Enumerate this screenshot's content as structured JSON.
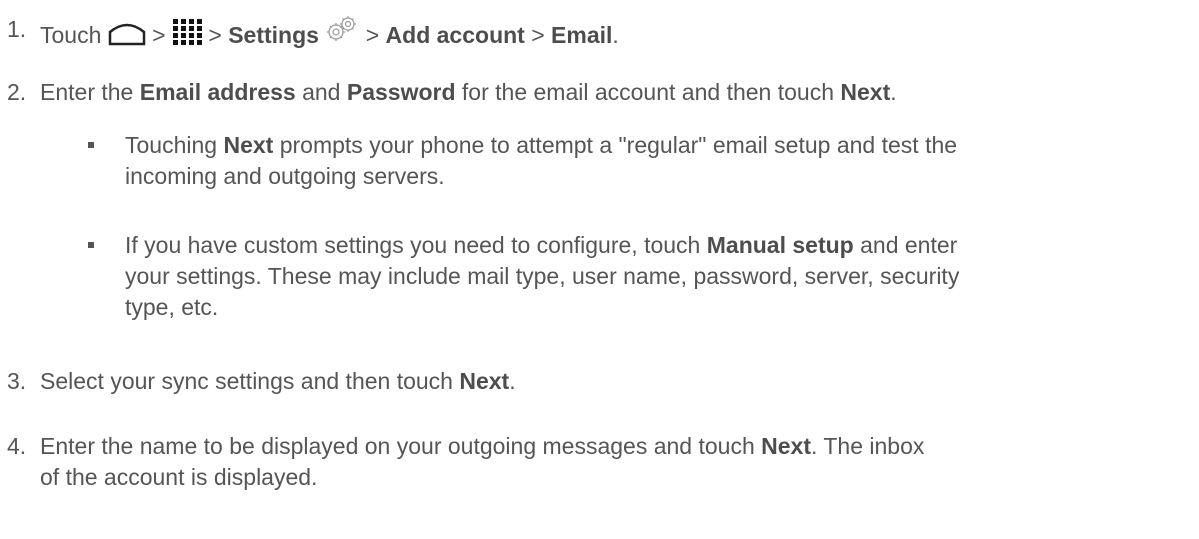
{
  "steps": [
    {
      "number": "1.",
      "touch": "Touch",
      "sep1": " > ",
      "sep2": " > ",
      "settings": "Settings",
      "sep3": " > ",
      "add_account": "Add account",
      "sep4": " > ",
      "email": "Email",
      "end": ".",
      "icons": [
        "home-icon",
        "apps-icon",
        "gear-icon"
      ]
    },
    {
      "number": "2.",
      "t1": "Enter the ",
      "email_address": "Email address",
      "t2": " and ",
      "password": "Password",
      "t3": " for the email account and then touch ",
      "next": "Next",
      "end": "."
    },
    {
      "number": "3.",
      "t1": "Select your sync settings and then touch ",
      "next": "Next",
      "end": "."
    },
    {
      "number": "4.",
      "t1": "Enter the name to be displayed on your outgoing messages and touch ",
      "next": "Next",
      "t2": ". The inbox",
      "t3": "of the account is displayed."
    }
  ],
  "bullets": [
    {
      "t1": "Touching ",
      "next": "Next",
      "t2": " prompts your phone to attempt a \"regular\" email setup and test the",
      "t3": "incoming and outgoing servers."
    },
    {
      "t1": "If you have custom settings you need to configure, touch ",
      "manual": "Manual setup",
      "t2": " and enter",
      "t3": "your settings. These may include mail type, user name, password, server, security",
      "t4": "type, etc."
    }
  ]
}
